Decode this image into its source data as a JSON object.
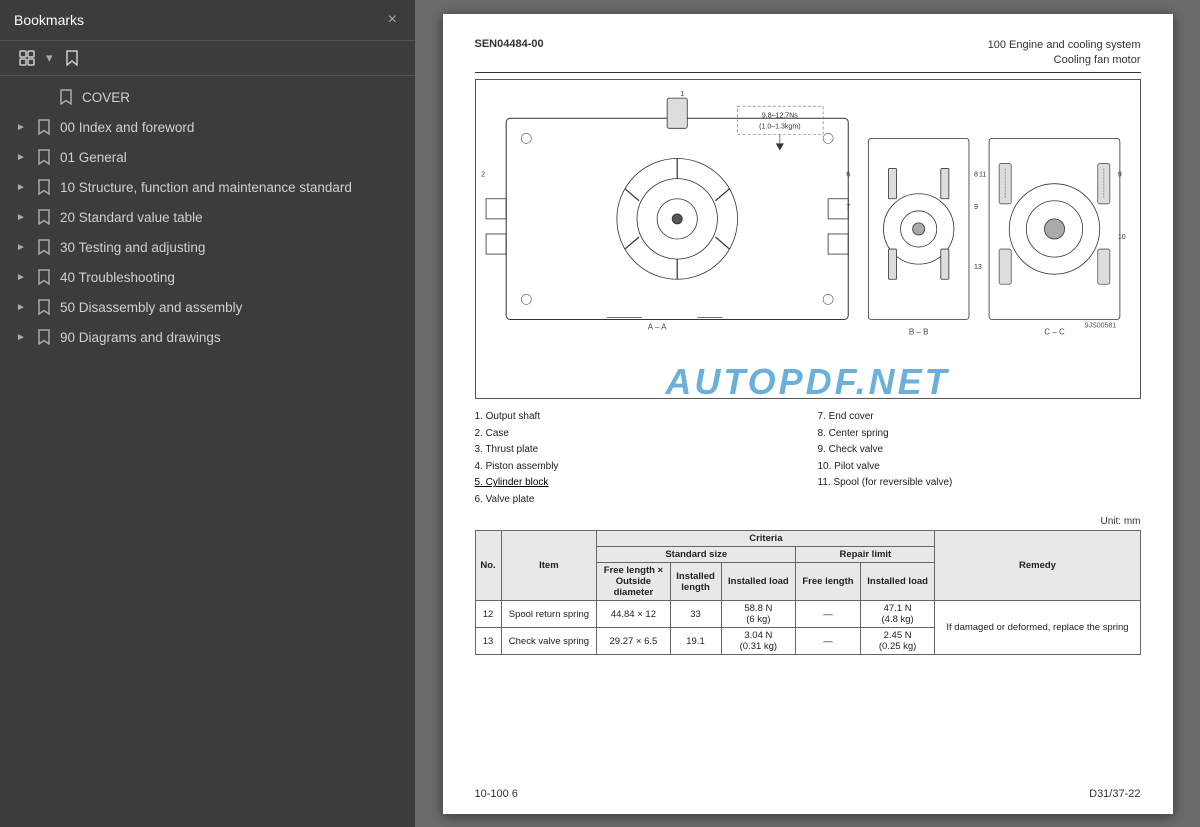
{
  "sidebar": {
    "title": "Bookmarks",
    "close_label": "×",
    "toolbar": {
      "expand_icon": "⊞",
      "bookmark_icon": "🔖"
    },
    "items": [
      {
        "id": "cover",
        "label": "COVER",
        "expandable": false,
        "indent": "cover"
      },
      {
        "id": "00",
        "label": "00 Index and foreword",
        "expandable": true,
        "indent": "top-level"
      },
      {
        "id": "01",
        "label": "01 General",
        "expandable": true,
        "indent": "top-level"
      },
      {
        "id": "10",
        "label": "10 Structure, function and maintenance standard",
        "expandable": true,
        "indent": "top-level"
      },
      {
        "id": "20",
        "label": "20 Standard value table",
        "expandable": true,
        "indent": "top-level"
      },
      {
        "id": "30",
        "label": "30 Testing and adjusting",
        "expandable": true,
        "indent": "top-level"
      },
      {
        "id": "40",
        "label": "40 Troubleshooting",
        "expandable": true,
        "indent": "top-level"
      },
      {
        "id": "50",
        "label": "50 Disassembly and assembly",
        "expandable": true,
        "indent": "top-level"
      },
      {
        "id": "90",
        "label": "90 Diagrams and drawings",
        "expandable": true,
        "indent": "top-level"
      }
    ]
  },
  "document": {
    "ref": "SEN04484-00",
    "section_line1": "100 Engine and cooling system",
    "section_line2": "Cooling fan motor",
    "diagram_label_aa": "A – A",
    "diagram_label_bb": "B – B",
    "diagram_label_cc": "C – C",
    "diagram_note": "9.8–12.7Ns\n(1.0–1.3kgm)",
    "figure_id": "9JS00581",
    "parts": [
      {
        "num": "1",
        "name": "Output shaft"
      },
      {
        "num": "2",
        "name": "Case"
      },
      {
        "num": "3",
        "name": "Thrust plate"
      },
      {
        "num": "4",
        "name": "Piston assembly"
      },
      {
        "num": "5",
        "name": "Cylinder block"
      },
      {
        "num": "6",
        "name": "Valve plate"
      },
      {
        "num": "7",
        "name": "End cover"
      },
      {
        "num": "8",
        "name": "Center spring"
      },
      {
        "num": "9",
        "name": "Check valve"
      },
      {
        "num": "10",
        "name": "Pilot valve"
      },
      {
        "num": "11",
        "name": "Spool  (for reversible valve)"
      }
    ],
    "unit_label": "Unit: mm",
    "table": {
      "headers": [
        "No.",
        "Item",
        "Criteria",
        "",
        "",
        "",
        "",
        "Remedy"
      ],
      "sub_headers_criteria": [
        "Standard size",
        "",
        "Repair limit",
        ""
      ],
      "sub_headers_std": [
        "Free length × Outside diameter",
        "Installed length",
        "Installed load",
        "Free length",
        "Installed load"
      ],
      "rows": [
        {
          "no": "12",
          "item": "Spool return spring",
          "free_length_od": "44.84 × 12",
          "installed_length": "33",
          "installed_load": "58.8 N\n(6 kg)",
          "repair_free_length": "—",
          "repair_installed_load": "47.1 N\n(4.8 kg)",
          "remedy": "If damaged or deformed, replace the spring"
        },
        {
          "no": "13",
          "item": "Check valve spring",
          "free_length_od": "29.27 × 6.5",
          "installed_length": "19.1",
          "installed_load": "3.04 N\n(0.31 kg)",
          "repair_free_length": "—",
          "repair_installed_load": "2.45 N\n(0.25 kg)",
          "remedy": ""
        }
      ]
    },
    "footer_left": "10-100  6",
    "footer_right": "D31/37-22",
    "watermark": "AUTOPDF.NET"
  }
}
